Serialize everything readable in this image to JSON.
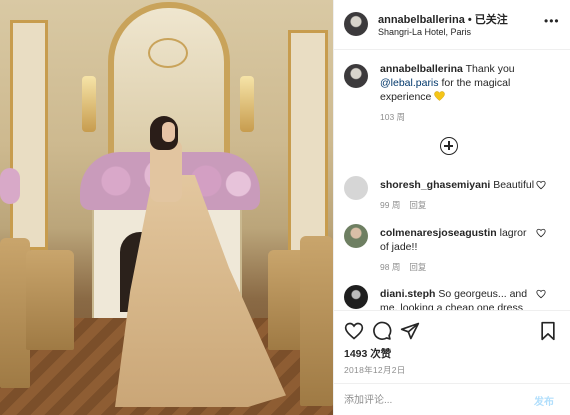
{
  "post": {
    "username": "annabelballerina",
    "follow_separator": " • ",
    "follow_label": "已关注",
    "location": "Shangri-La Hotel, Paris",
    "more_label": "•••"
  },
  "caption": {
    "username": "annabelballerina",
    "text_before": " Thank you ",
    "mention": "@lebal.paris",
    "text_after": " for the magical experience",
    "emoji": "yellow-heart",
    "time": "103 周"
  },
  "comments": [
    {
      "username": "shoresh_ghasemiyani",
      "text": " Beautiful",
      "time": "99 周",
      "reply": "回复"
    },
    {
      "username": "colmenaresjoseagustin",
      "text": " lagror of jade!!",
      "time": "98 周",
      "reply": "回复"
    },
    {
      "username": "diani.steph",
      "text": " So georgeus... and me, looking a cheap one dress",
      "time": "",
      "reply": ""
    }
  ],
  "footer": {
    "likes": "1493 次赞",
    "date": "2018年12月2日",
    "comment_placeholder": "添加评论...",
    "post_label": "发布"
  },
  "colors": {
    "mention": "#00376b",
    "meta": "#8e8e8e",
    "post_button": "#b2dffc",
    "heart_emoji": "#f5c518"
  }
}
